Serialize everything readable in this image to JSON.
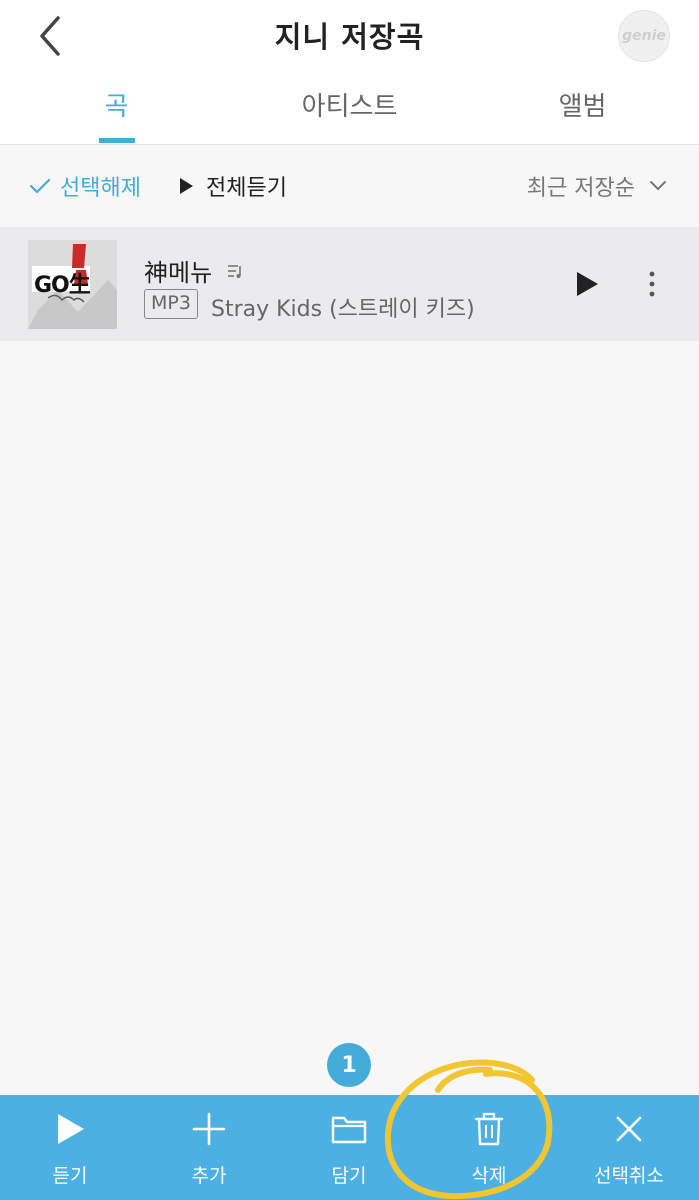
{
  "header": {
    "title": "지니 저장곡",
    "logo_text": "genie"
  },
  "tabs": [
    {
      "label": "곡",
      "active": true
    },
    {
      "label": "아티스트",
      "active": false
    },
    {
      "label": "앨범",
      "active": false
    }
  ],
  "toolbar": {
    "deselect_label": "선택해제",
    "play_all_label": "전체듣기",
    "sort_label": "최근 저장순"
  },
  "songs": [
    {
      "title": "神메뉴",
      "format": "MP3",
      "artist": "Stray Kids (스트레이 키즈)",
      "album_art_text": "GO生",
      "selected": true
    }
  ],
  "selection_count": "1",
  "bottom_bar": {
    "items": [
      {
        "label": "듣기",
        "icon": "play-icon"
      },
      {
        "label": "추가",
        "icon": "plus-icon"
      },
      {
        "label": "담기",
        "icon": "folder-icon"
      },
      {
        "label": "삭제",
        "icon": "trash-icon"
      },
      {
        "label": "선택취소",
        "icon": "close-icon"
      }
    ]
  },
  "colors": {
    "accent": "#45abd9",
    "bottom_bar": "#4db0e2",
    "selected_row": "#ebebee",
    "annotation": "#f2c631"
  }
}
